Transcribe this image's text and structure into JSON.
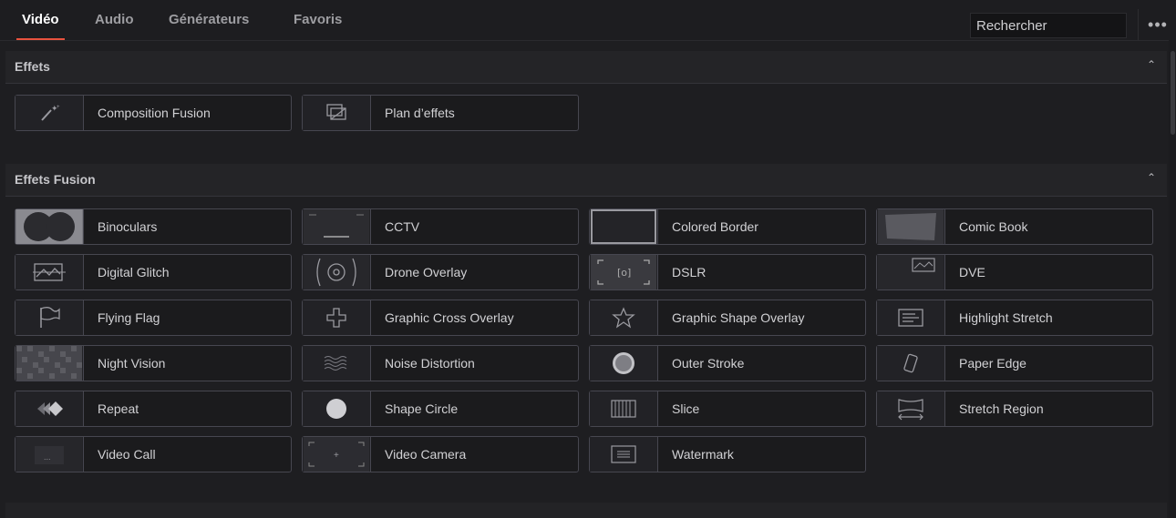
{
  "tabs": [
    {
      "label": "Vidéo",
      "active": true
    },
    {
      "label": "Audio",
      "active": false
    },
    {
      "label": "Générateurs",
      "active": false
    },
    {
      "label": "Favoris",
      "active": false
    }
  ],
  "search": {
    "value": "Rechercher"
  },
  "more_label": "•••",
  "sections": [
    {
      "title": "Effets",
      "collapse_icon": "chevron-up-icon",
      "items": [
        {
          "label": "Composition Fusion",
          "icon": "magic-wand-icon"
        },
        {
          "label": "Plan d’effets",
          "icon": "adjustment-layer-icon"
        }
      ]
    },
    {
      "title": "Effets Fusion",
      "collapse_icon": "chevron-up-icon",
      "items": [
        {
          "label": "Binoculars",
          "icon": "binoculars-thumb"
        },
        {
          "label": "CCTV",
          "icon": "cctv-thumb"
        },
        {
          "label": "Colored Border",
          "icon": "colored-border-thumb"
        },
        {
          "label": "Comic Book",
          "icon": "comic-book-thumb"
        },
        {
          "label": "Digital Glitch",
          "icon": "digital-glitch-thumb"
        },
        {
          "label": "Drone Overlay",
          "icon": "drone-overlay-thumb"
        },
        {
          "label": "DSLR",
          "icon": "dslr-thumb"
        },
        {
          "label": "DVE",
          "icon": "dve-thumb"
        },
        {
          "label": "Flying Flag",
          "icon": "flag-icon"
        },
        {
          "label": "Graphic Cross Overlay",
          "icon": "cross-icon"
        },
        {
          "label": "Graphic Shape Overlay",
          "icon": "star-icon"
        },
        {
          "label": "Highlight Stretch",
          "icon": "highlight-stretch-icon"
        },
        {
          "label": "Night Vision",
          "icon": "night-vision-thumb"
        },
        {
          "label": "Noise Distortion",
          "icon": "noise-distortion-icon"
        },
        {
          "label": "Outer Stroke",
          "icon": "outer-stroke-icon"
        },
        {
          "label": "Paper Edge",
          "icon": "paper-edge-icon"
        },
        {
          "label": "Repeat",
          "icon": "repeat-icon"
        },
        {
          "label": "Shape Circle",
          "icon": "circle-icon"
        },
        {
          "label": "Slice",
          "icon": "slice-icon"
        },
        {
          "label": "Stretch Region",
          "icon": "stretch-region-icon"
        },
        {
          "label": "Video Call",
          "icon": "video-call-thumb"
        },
        {
          "label": "Video Camera",
          "icon": "video-camera-thumb"
        },
        {
          "label": "Watermark",
          "icon": "watermark-icon"
        }
      ]
    }
  ]
}
